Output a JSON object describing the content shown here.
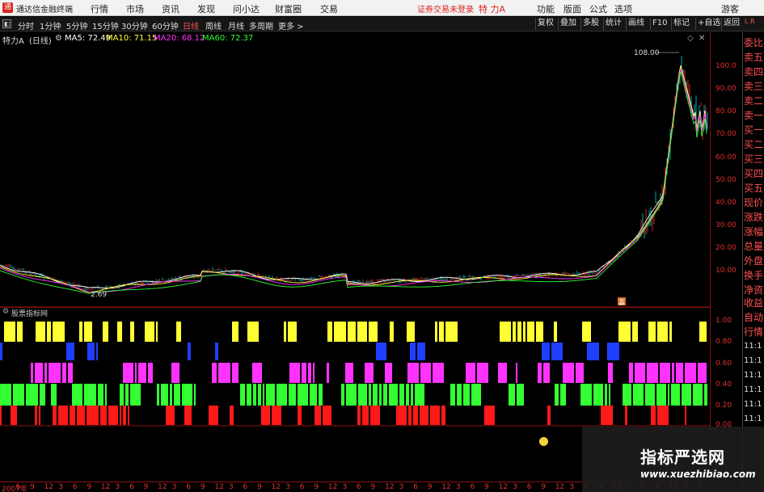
{
  "titlebar": {
    "app_name": "通达信金融终端",
    "menu": [
      "行情",
      "市场",
      "资讯",
      "发现",
      "问小达",
      "财富圈",
      "交易"
    ],
    "login_status": "证券交易未登录",
    "stock_title": "特 力A",
    "right_menu": [
      "功能",
      "版面",
      "公式",
      "选项"
    ],
    "guest": "游客"
  },
  "toolbar": {
    "periods": [
      "分时",
      "1分钟",
      "5分钟",
      "15分钟",
      "30分钟",
      "60分钟",
      "日线",
      "周线",
      "月线",
      "多周期",
      "更多 >"
    ],
    "active_period": "日线",
    "right_buttons": [
      "复权",
      "叠加",
      "多股",
      "统计",
      "画线",
      "F10",
      "标记",
      "+自选",
      "返回"
    ]
  },
  "infobar": {
    "stock_label": "特力A",
    "period_label": "(日线)",
    "ma5": "MA5: 72.49",
    "ma10": "MA10: 71.15",
    "ma20": "MA20: 68.12",
    "ma60": "MA60: 72.37"
  },
  "right_panel": {
    "items": [
      "委比",
      "卖五",
      "卖四",
      "卖三",
      "卖二",
      "卖一",
      "买一",
      "买二",
      "买三",
      "买四",
      "买五",
      "现价",
      "涨跌",
      "涨幅",
      "总量",
      "外盘",
      "换手",
      "净资",
      "收益"
    ],
    "sub_items": [
      "自动",
      "行情",
      "11:1",
      "11:1",
      "11:1",
      "11:1",
      "11:1",
      "11:1"
    ]
  },
  "price_axis": {
    "ticks": [
      "100.0",
      "90.00",
      "80.00",
      "70.00",
      "60.00",
      "50.00",
      "40.00",
      "30.00",
      "20.00",
      "10.00"
    ]
  },
  "indicator": {
    "name": "股票指标网",
    "ticks": [
      "1.00",
      "0.80",
      "0.60",
      "0.40",
      "0.20",
      "0.00"
    ]
  },
  "annotations": {
    "high_label": "108.00",
    "low_label": "2.69",
    "mark_label": "寡"
  },
  "time_axis": {
    "labels": [
      "2007年",
      "6",
      "9",
      "12",
      "3",
      "6",
      "9",
      "12",
      "3",
      "6",
      "9",
      "12",
      "3",
      "6",
      "9",
      "12",
      "3",
      "6",
      "9",
      "12",
      "3",
      "6",
      "9",
      "12",
      "3",
      "6",
      "9",
      "12",
      "3",
      "6",
      "9",
      "12",
      "3",
      "6",
      "9",
      "12",
      "3",
      "6",
      "9",
      "12",
      "3",
      "6",
      "9",
      "12",
      "3",
      "6",
      "9",
      "12",
      "3",
      "7"
    ]
  },
  "watermark": {
    "title": "指标严选网",
    "url": "www.xuezhibiao.com"
  },
  "colors": {
    "up": "#ff3333",
    "down": "#00d8d8",
    "yellow": "#ffff33",
    "blue": "#1f3fff",
    "magenta": "#ff33ff",
    "green": "#33ff33",
    "red": "#ff1a1a",
    "axis": "#e03030"
  }
}
